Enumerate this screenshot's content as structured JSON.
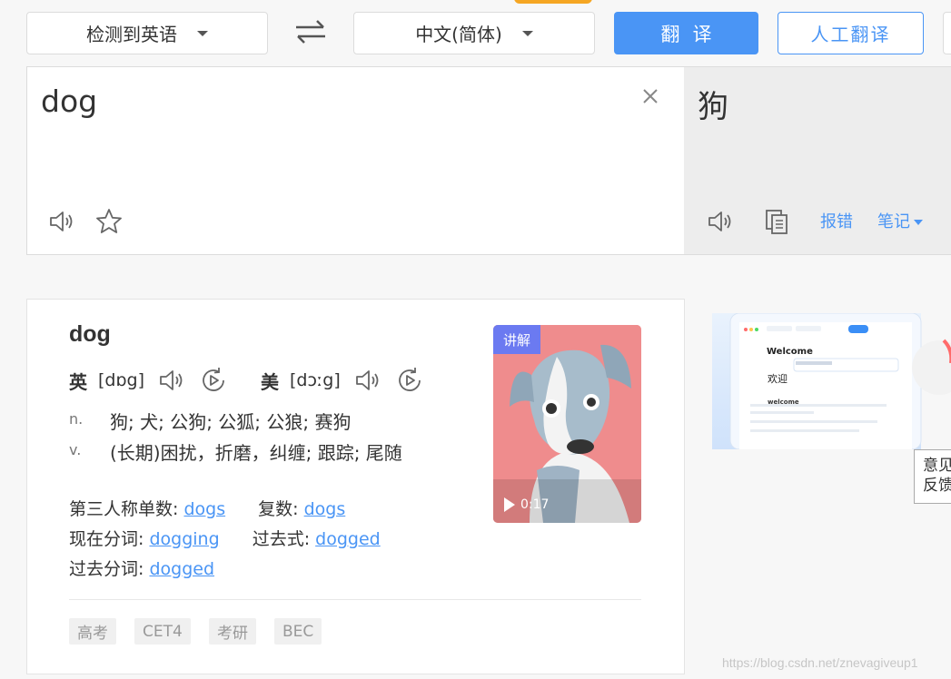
{
  "toolbar": {
    "source_lang": "检测到英语",
    "target_lang": "中文(简体)",
    "translate_label": "翻译",
    "human_translate_label": "人工翻译"
  },
  "input": {
    "text": "dog"
  },
  "output": {
    "text": "狗",
    "report_label": "报错",
    "notes_label": "笔记"
  },
  "dictionary": {
    "word": "dog",
    "uk_label": "英",
    "uk_ipa": "[dɒg]",
    "us_label": "美",
    "us_ipa": "[dɔːg]",
    "definitions": [
      {
        "pos": "n.",
        "meaning": "狗; 犬; 公狗; 公狐; 公狼; 赛狗"
      },
      {
        "pos": "v.",
        "meaning": "(长期)困扰，折磨，纠缠; 跟踪; 尾随"
      }
    ],
    "forms": {
      "third_person_label": "第三人称单数:",
      "third_person": "dogs",
      "plural_label": "复数:",
      "plural": "dogs",
      "present_participle_label": "现在分词:",
      "present_participle": "dogging",
      "past_tense_label": "过去式:",
      "past_tense": "dogged",
      "past_participle_label": "过去分词:",
      "past_participle": "dogged"
    },
    "tags": [
      "高考",
      "CET4",
      "考研",
      "BEC"
    ],
    "video": {
      "badge": "讲解",
      "duration": "0:17"
    }
  },
  "ad": {
    "welcome": "Welcome",
    "welcome_cn": "欢迎",
    "welcome_small": "welcome"
  },
  "feedback": {
    "line1": "意见",
    "line2": "反馈"
  },
  "watermark": "https://blog.csdn.net/znevagiveup1",
  "colors": {
    "accent": "#4a95f5",
    "orange": "#f5a623",
    "badge": "#6b7af1"
  }
}
